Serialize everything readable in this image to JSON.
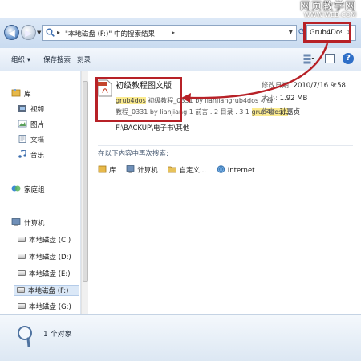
{
  "watermark": {
    "cn": "网页教学网",
    "en": "WWW.WEB.COM"
  },
  "address": {
    "path": "\"本地磁盘 (F:)\" 中的搜索结果",
    "search_value": "Grub4Dos"
  },
  "toolbar": {
    "organize": "组织 ▾",
    "save_search": "保存搜索",
    "burn": "刻录"
  },
  "nav": {
    "libraries": "库",
    "videos": "视频",
    "pictures": "图片",
    "documents": "文档",
    "music": "音乐",
    "homegroup": "家庭组",
    "computer": "计算机",
    "drives": [
      "本地磁盘 (C:)",
      "本地磁盘 (D:)",
      "本地磁盘 (E:)",
      "本地磁盘 (F:)",
      "本地磁盘 (G:)"
    ]
  },
  "result": {
    "title": "初级教程图文版",
    "snippet1_hl": "grub4dos",
    "snippet1_rest": " 初级教程_0331 by lianjiangrub4dos 初级",
    "snippet2_pre": "教程_0331 by lianjiang 1 前言 . 2 目录 . 3 1 ",
    "snippet2_hl": "grub4dos...",
    "path": "F:\\BACKUP\\电子书\\其他",
    "modified_label": "修改日期:",
    "modified_value": "2010/7/16 9:58",
    "size_label": "大小:",
    "size_value": "1.92 MB",
    "author_label": "作者:",
    "author_value": "孙嘉贞"
  },
  "search_again": {
    "heading": "在以下内容中再次搜索:",
    "items": [
      "库",
      "计算机",
      "自定义...",
      "Internet"
    ]
  },
  "status": {
    "text": "1 个对象"
  },
  "colors": {
    "callout": "#b72127",
    "highlight": "#fbeb8f",
    "chrome": "#dde9f7"
  }
}
